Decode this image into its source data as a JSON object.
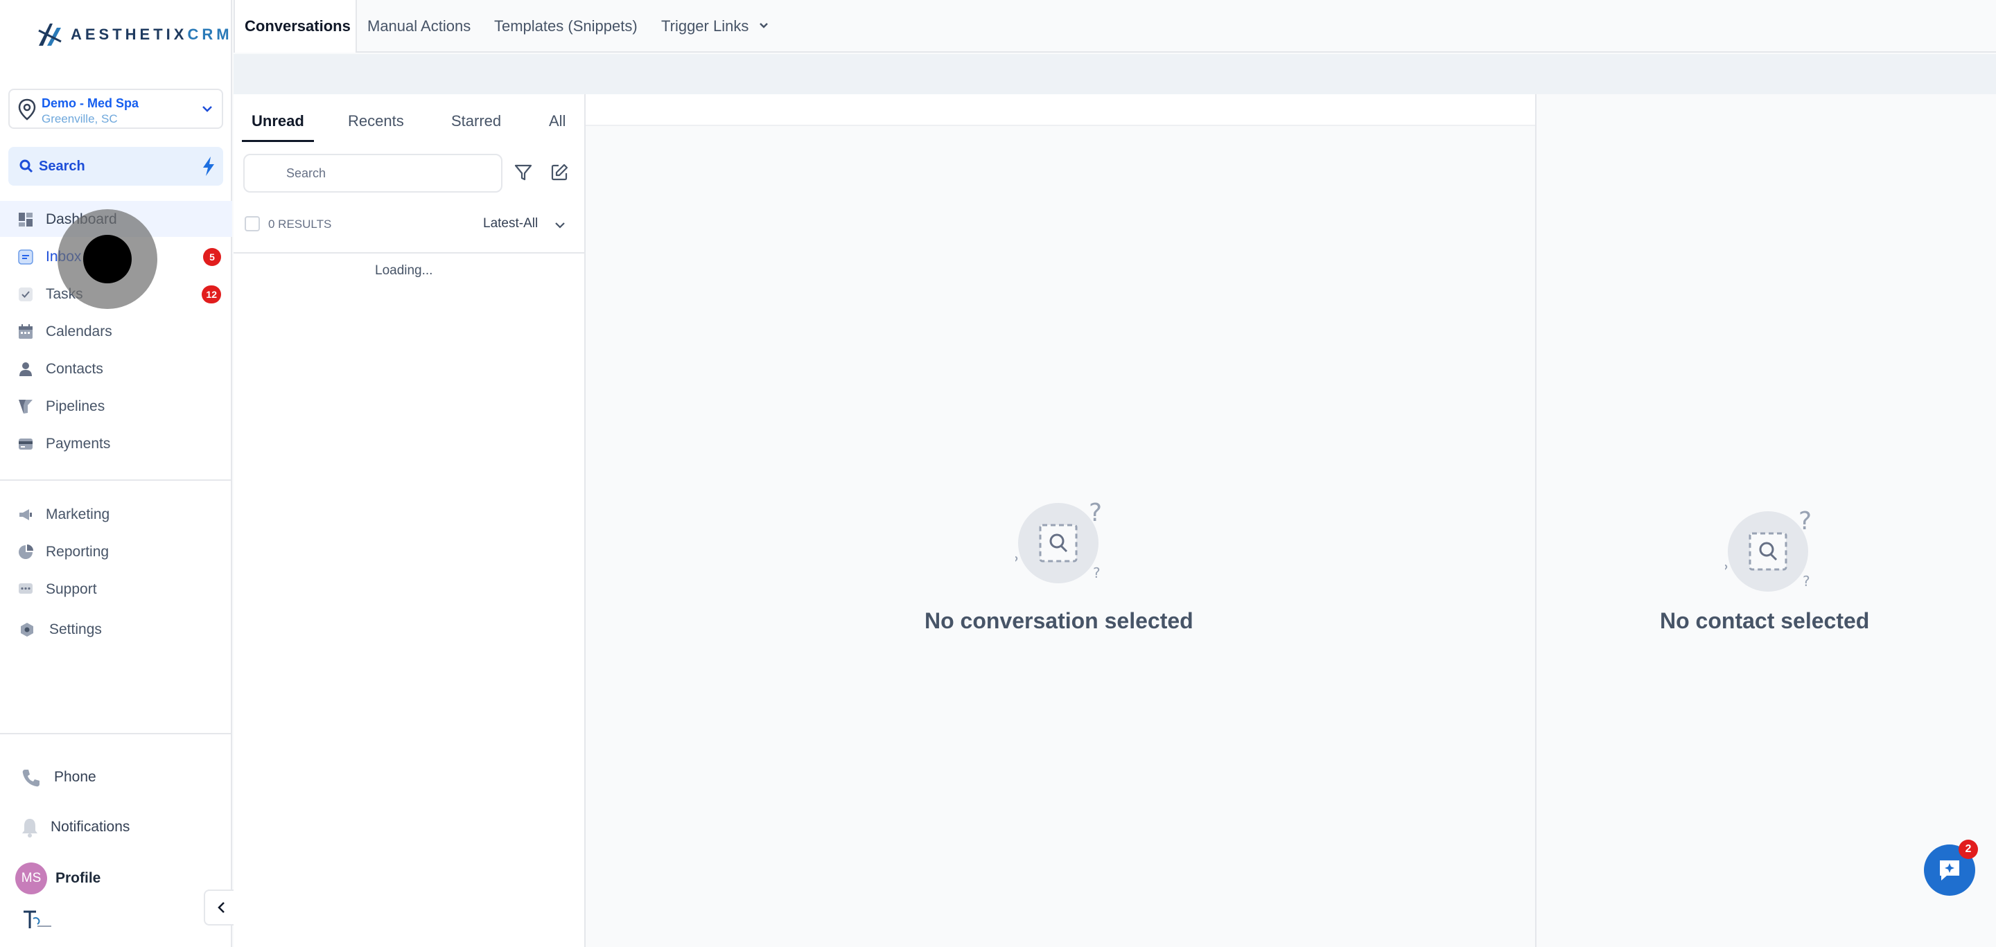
{
  "brand": {
    "logo_main": "AESTHETIX",
    "logo_suffix": "CRM",
    "accent": "#155eef"
  },
  "location": {
    "name": "Demo - Med Spa",
    "city": "Greenville, SC"
  },
  "sidebar": {
    "search_label": "Search",
    "items": [
      {
        "label": "Dashboard",
        "icon": "dashboard-icon"
      },
      {
        "label": "Inbox",
        "icon": "inbox-icon",
        "badge": "5"
      },
      {
        "label": "Tasks",
        "icon": "tasks-icon",
        "badge": "12"
      },
      {
        "label": "Calendars",
        "icon": "calendar-icon"
      },
      {
        "label": "Contacts",
        "icon": "contacts-icon"
      },
      {
        "label": "Pipelines",
        "icon": "pipelines-icon"
      },
      {
        "label": "Payments",
        "icon": "payments-icon"
      },
      {
        "label": "Marketing",
        "icon": "marketing-icon"
      },
      {
        "label": "Reporting",
        "icon": "reporting-icon"
      },
      {
        "label": "Support",
        "icon": "support-icon"
      },
      {
        "label": "Settings",
        "icon": "settings-icon"
      }
    ],
    "bottom": {
      "phone": "Phone",
      "notifications": "Notifications",
      "profile": "Profile",
      "avatar_initials": "MS"
    }
  },
  "topbar": {
    "tabs": [
      "Conversations",
      "Manual Actions",
      "Templates (Snippets)",
      "Trigger Links"
    ]
  },
  "conversation_list": {
    "tabs": [
      "Unread",
      "Recents",
      "Starred",
      "All"
    ],
    "search_placeholder": "Search",
    "results": "0 RESULTS",
    "sort": "Latest-All",
    "loading": "Loading..."
  },
  "conversation_area": {
    "empty_title": "No conversation selected"
  },
  "contact_area": {
    "empty_title": "No contact selected"
  },
  "chat_widget": {
    "badge": "2"
  }
}
